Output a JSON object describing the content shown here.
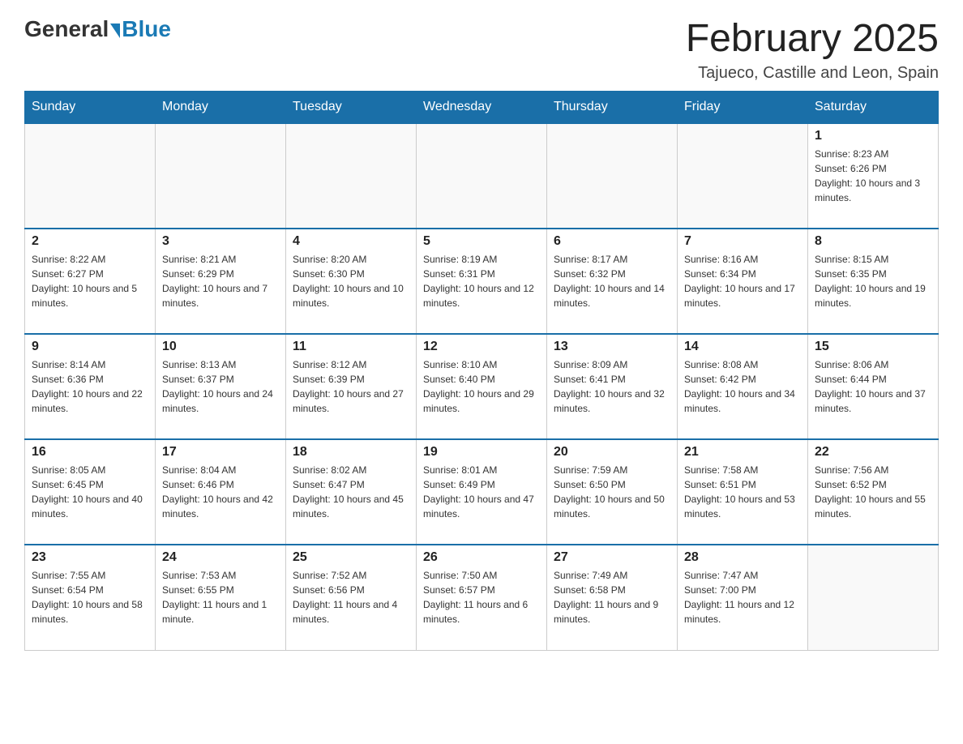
{
  "header": {
    "logo_general": "General",
    "logo_blue": "Blue",
    "calendar_title": "February 2025",
    "location": "Tajueco, Castille and Leon, Spain"
  },
  "days_of_week": [
    "Sunday",
    "Monday",
    "Tuesday",
    "Wednesday",
    "Thursday",
    "Friday",
    "Saturday"
  ],
  "weeks": [
    [
      {
        "day": "",
        "info": ""
      },
      {
        "day": "",
        "info": ""
      },
      {
        "day": "",
        "info": ""
      },
      {
        "day": "",
        "info": ""
      },
      {
        "day": "",
        "info": ""
      },
      {
        "day": "",
        "info": ""
      },
      {
        "day": "1",
        "info": "Sunrise: 8:23 AM\nSunset: 6:26 PM\nDaylight: 10 hours and 3 minutes."
      }
    ],
    [
      {
        "day": "2",
        "info": "Sunrise: 8:22 AM\nSunset: 6:27 PM\nDaylight: 10 hours and 5 minutes."
      },
      {
        "day": "3",
        "info": "Sunrise: 8:21 AM\nSunset: 6:29 PM\nDaylight: 10 hours and 7 minutes."
      },
      {
        "day": "4",
        "info": "Sunrise: 8:20 AM\nSunset: 6:30 PM\nDaylight: 10 hours and 10 minutes."
      },
      {
        "day": "5",
        "info": "Sunrise: 8:19 AM\nSunset: 6:31 PM\nDaylight: 10 hours and 12 minutes."
      },
      {
        "day": "6",
        "info": "Sunrise: 8:17 AM\nSunset: 6:32 PM\nDaylight: 10 hours and 14 minutes."
      },
      {
        "day": "7",
        "info": "Sunrise: 8:16 AM\nSunset: 6:34 PM\nDaylight: 10 hours and 17 minutes."
      },
      {
        "day": "8",
        "info": "Sunrise: 8:15 AM\nSunset: 6:35 PM\nDaylight: 10 hours and 19 minutes."
      }
    ],
    [
      {
        "day": "9",
        "info": "Sunrise: 8:14 AM\nSunset: 6:36 PM\nDaylight: 10 hours and 22 minutes."
      },
      {
        "day": "10",
        "info": "Sunrise: 8:13 AM\nSunset: 6:37 PM\nDaylight: 10 hours and 24 minutes."
      },
      {
        "day": "11",
        "info": "Sunrise: 8:12 AM\nSunset: 6:39 PM\nDaylight: 10 hours and 27 minutes."
      },
      {
        "day": "12",
        "info": "Sunrise: 8:10 AM\nSunset: 6:40 PM\nDaylight: 10 hours and 29 minutes."
      },
      {
        "day": "13",
        "info": "Sunrise: 8:09 AM\nSunset: 6:41 PM\nDaylight: 10 hours and 32 minutes."
      },
      {
        "day": "14",
        "info": "Sunrise: 8:08 AM\nSunset: 6:42 PM\nDaylight: 10 hours and 34 minutes."
      },
      {
        "day": "15",
        "info": "Sunrise: 8:06 AM\nSunset: 6:44 PM\nDaylight: 10 hours and 37 minutes."
      }
    ],
    [
      {
        "day": "16",
        "info": "Sunrise: 8:05 AM\nSunset: 6:45 PM\nDaylight: 10 hours and 40 minutes."
      },
      {
        "day": "17",
        "info": "Sunrise: 8:04 AM\nSunset: 6:46 PM\nDaylight: 10 hours and 42 minutes."
      },
      {
        "day": "18",
        "info": "Sunrise: 8:02 AM\nSunset: 6:47 PM\nDaylight: 10 hours and 45 minutes."
      },
      {
        "day": "19",
        "info": "Sunrise: 8:01 AM\nSunset: 6:49 PM\nDaylight: 10 hours and 47 minutes."
      },
      {
        "day": "20",
        "info": "Sunrise: 7:59 AM\nSunset: 6:50 PM\nDaylight: 10 hours and 50 minutes."
      },
      {
        "day": "21",
        "info": "Sunrise: 7:58 AM\nSunset: 6:51 PM\nDaylight: 10 hours and 53 minutes."
      },
      {
        "day": "22",
        "info": "Sunrise: 7:56 AM\nSunset: 6:52 PM\nDaylight: 10 hours and 55 minutes."
      }
    ],
    [
      {
        "day": "23",
        "info": "Sunrise: 7:55 AM\nSunset: 6:54 PM\nDaylight: 10 hours and 58 minutes."
      },
      {
        "day": "24",
        "info": "Sunrise: 7:53 AM\nSunset: 6:55 PM\nDaylight: 11 hours and 1 minute."
      },
      {
        "day": "25",
        "info": "Sunrise: 7:52 AM\nSunset: 6:56 PM\nDaylight: 11 hours and 4 minutes."
      },
      {
        "day": "26",
        "info": "Sunrise: 7:50 AM\nSunset: 6:57 PM\nDaylight: 11 hours and 6 minutes."
      },
      {
        "day": "27",
        "info": "Sunrise: 7:49 AM\nSunset: 6:58 PM\nDaylight: 11 hours and 9 minutes."
      },
      {
        "day": "28",
        "info": "Sunrise: 7:47 AM\nSunset: 7:00 PM\nDaylight: 11 hours and 12 minutes."
      },
      {
        "day": "",
        "info": ""
      }
    ]
  ]
}
